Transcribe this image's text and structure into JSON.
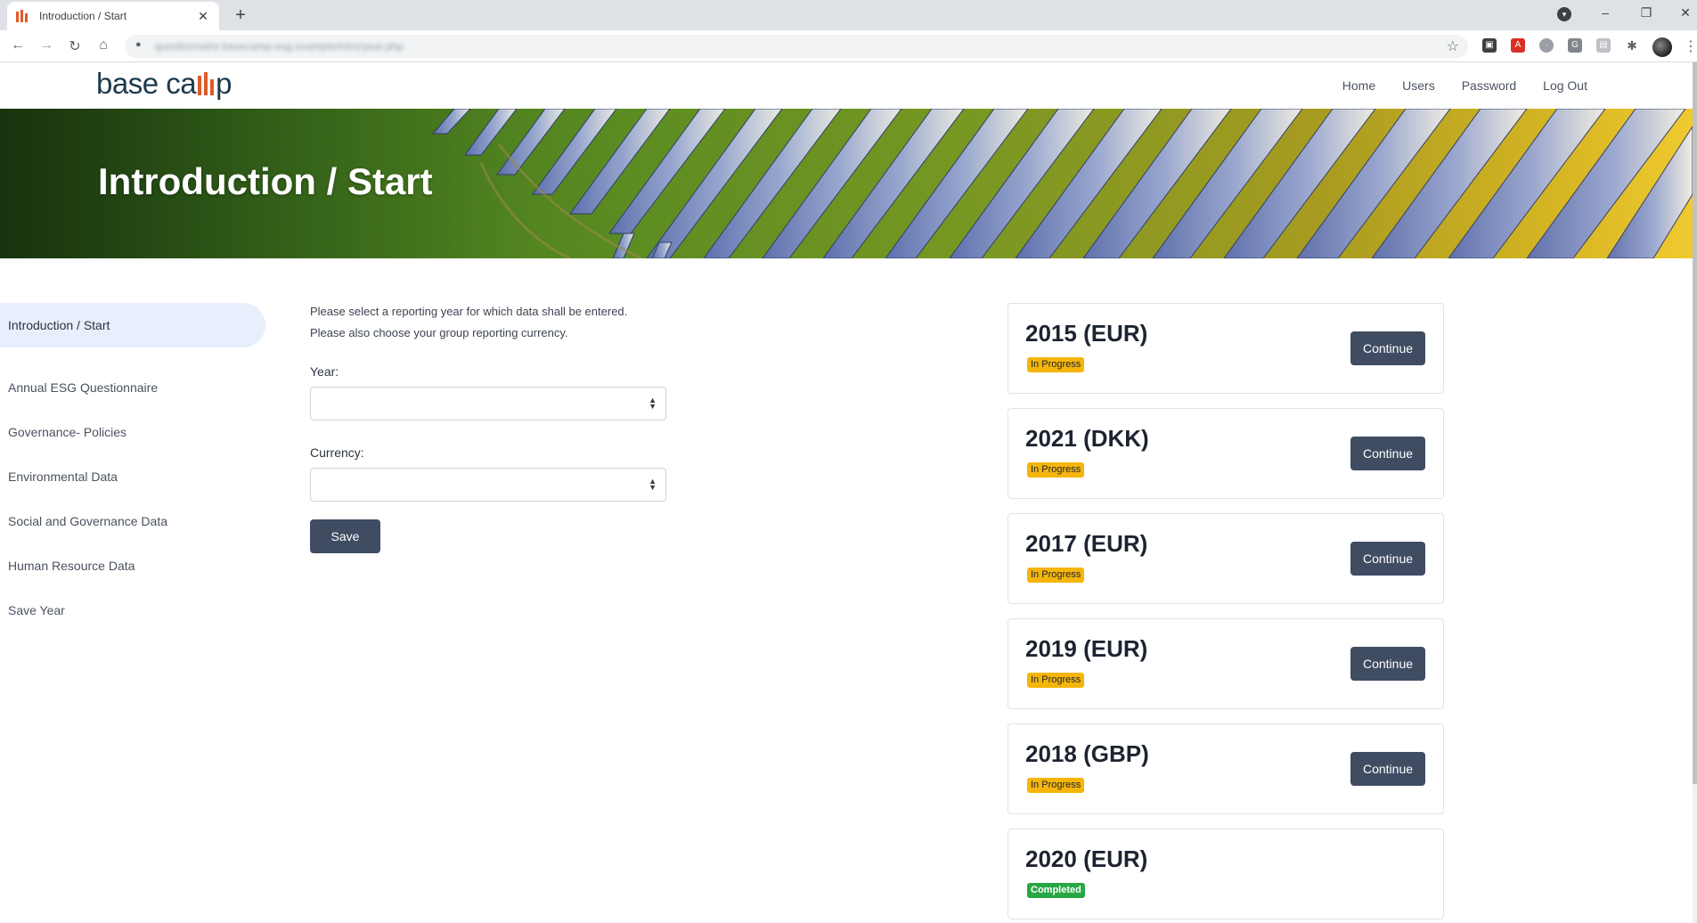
{
  "browser": {
    "tab_title": "Introduction / Start",
    "new_tab_glyph": "+",
    "close_glyph": "✕",
    "url": "questionnaire.basecamp-esg.example/intro/year.php"
  },
  "header": {
    "logo_text_left": "base ca",
    "logo_text_right": "p",
    "nav": [
      {
        "label": "Home"
      },
      {
        "label": "Users"
      },
      {
        "label": "Password"
      },
      {
        "label": "Log Out"
      }
    ]
  },
  "hero": {
    "title": "Introduction / Start"
  },
  "sidebar": {
    "items": [
      {
        "label": "Introduction / Start",
        "active": true
      },
      {
        "label": "Annual ESG Questionnaire"
      },
      {
        "label": "Governance- Policies"
      },
      {
        "label": "Environmental Data"
      },
      {
        "label": "Social and Governance Data"
      },
      {
        "label": "Human Resource Data"
      },
      {
        "label": "Save Year"
      }
    ]
  },
  "form": {
    "intro_line1": "Please select a reporting year for which data shall be entered.",
    "intro_line2": "Please also choose your group reporting currency.",
    "year_label": "Year:",
    "year_value": "",
    "currency_label": "Currency:",
    "currency_value": "",
    "save_label": "Save"
  },
  "years": [
    {
      "title": "2015 (EUR)",
      "status": "In Progress",
      "action": "Continue"
    },
    {
      "title": "2021 (DKK)",
      "status": "In Progress",
      "action": "Continue"
    },
    {
      "title": "2017 (EUR)",
      "status": "In Progress",
      "action": "Continue"
    },
    {
      "title": "2019 (EUR)",
      "status": "In Progress",
      "action": "Continue"
    },
    {
      "title": "2018 (GBP)",
      "status": "In Progress",
      "action": "Continue"
    },
    {
      "title": "2020 (EUR)",
      "status": "Completed",
      "action": ""
    }
  ],
  "colors": {
    "accent_orange": "#e05a2b",
    "button_dark": "#3f4c62",
    "badge_in_progress": "#f5b50a",
    "badge_completed": "#28a745",
    "sidebar_active_bg": "#e7effd"
  }
}
